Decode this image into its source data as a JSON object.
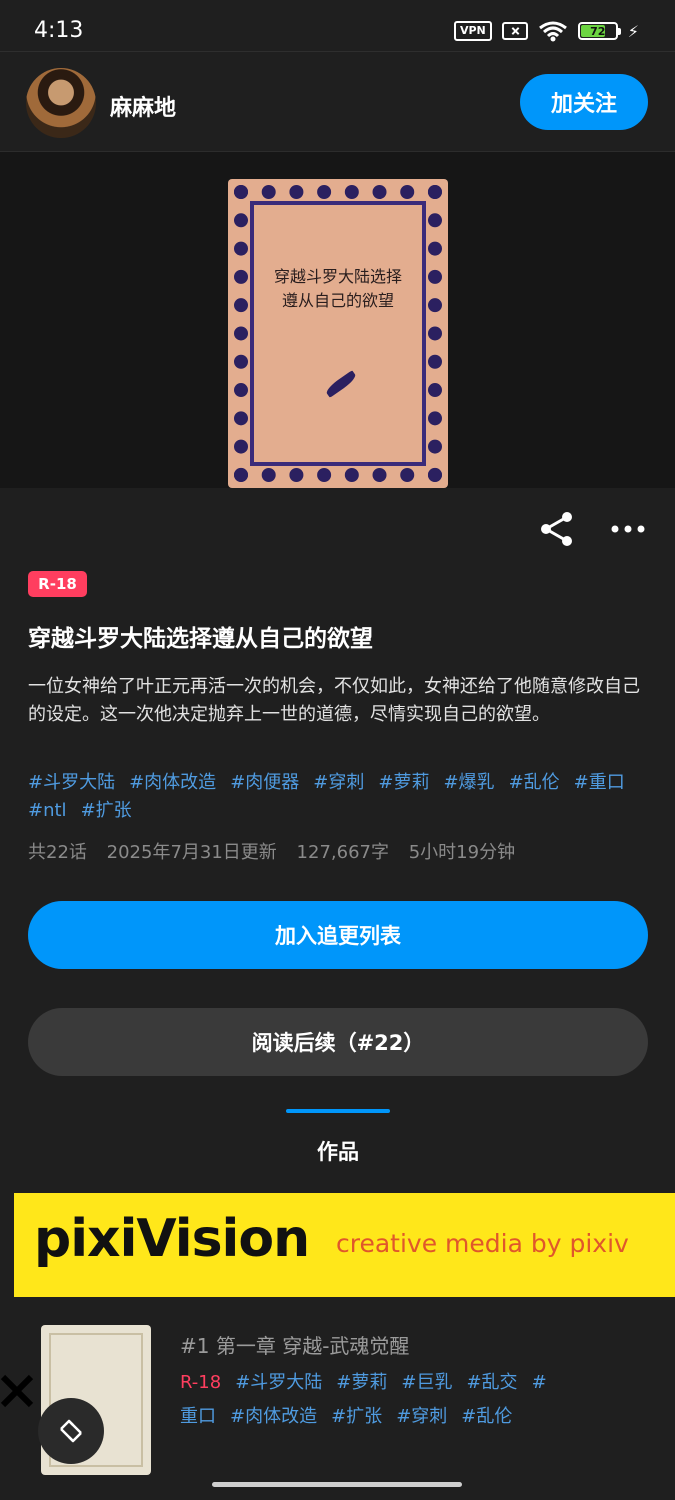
{
  "status_bar": {
    "time": "4:13",
    "vpn_label": "VPN",
    "battery_level": "72",
    "battery_fraction": 0.72
  },
  "header": {
    "username": "麻麻地",
    "follow_label": "加关注"
  },
  "cover": {
    "title_text": "穿越斗罗大陆选择遵从自己的欲望"
  },
  "work": {
    "badge": "R-18",
    "title": "穿越斗罗大陆选择遵从自己的欲望",
    "description": "一位女神给了叶正元再活一次的机会，不仅如此，女神还给了他随意修改自己的设定。这一次他决定抛弃上一世的道德，尽情实现自己的欲望。",
    "tags": [
      "#斗罗大陆",
      "#肉体改造",
      "#肉便器",
      "#穿刺",
      "#萝莉",
      "#爆乳",
      "#乱伦",
      "#重口",
      "#ntl",
      "#扩张"
    ],
    "meta": {
      "episodes": "共22话",
      "updated": "2025年7月31日更新",
      "chars": "127,667字",
      "read_time": "5小时19分钟"
    },
    "add_watchlist_label": "加入追更列表",
    "continue_label": "阅读后续（#22）"
  },
  "tabs": {
    "active": "作品"
  },
  "banner": {
    "logo": "pixiVision",
    "tagline": "creative media by pixiv"
  },
  "chapter": {
    "title": "#1 第一章 穿越-武魂觉醒",
    "badge": "R-18",
    "tags": [
      "#斗罗大陆",
      "#萝莉",
      "#巨乳",
      "#乱交",
      "#重口",
      "#肉体改造",
      "#扩张",
      "#穿刺",
      "#乱伦"
    ]
  },
  "colors": {
    "accent": "#0096fa",
    "r18": "#ff3e5f",
    "tag": "#4f9be0",
    "background": "#1f1f1f"
  }
}
